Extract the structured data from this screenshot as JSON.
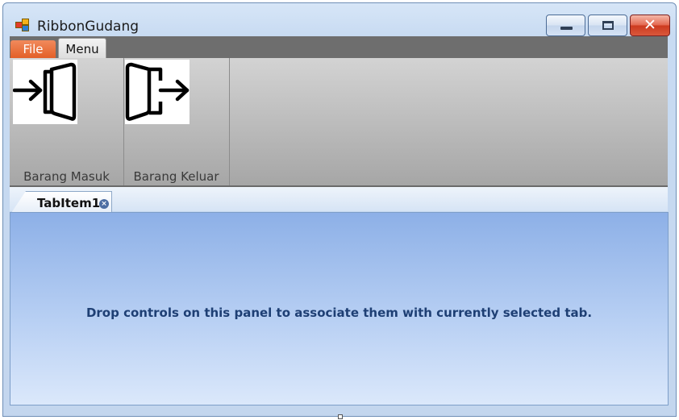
{
  "window": {
    "title": "RibbonGudang",
    "close_glyph": "✕"
  },
  "ribbon": {
    "file_tab": "File",
    "menu_tab": "Menu",
    "groups": [
      {
        "label": "Barang Masuk",
        "icon": "door-enter-icon"
      },
      {
        "label": "Barang Keluar",
        "icon": "door-exit-icon"
      }
    ]
  },
  "tabs": {
    "items": [
      {
        "label": "TabItem1"
      }
    ],
    "close_glyph": "×"
  },
  "panel": {
    "message": "Drop controls on this panel to associate them with currently selected tab."
  }
}
